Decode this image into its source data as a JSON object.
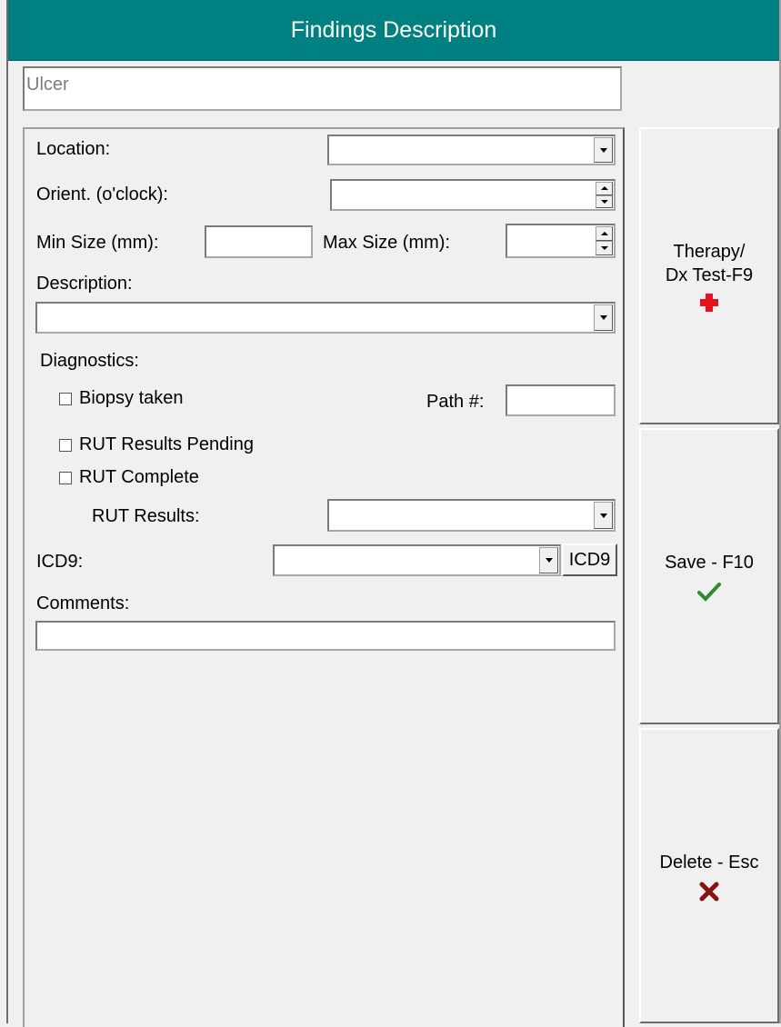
{
  "window": {
    "title": "Findings Description"
  },
  "finding": {
    "value": "Ulcer"
  },
  "form": {
    "location": {
      "label": "Location:",
      "value": ""
    },
    "orient": {
      "label": "Orient. (o'clock):",
      "value": ""
    },
    "min_size": {
      "label": "Min Size (mm):",
      "value": ""
    },
    "max_size": {
      "label": "Max Size (mm):",
      "value": ""
    },
    "description": {
      "label": "Description:",
      "value": ""
    },
    "diagnostics": {
      "label": "Diagnostics:",
      "biopsy_taken": {
        "label": "Biopsy taken",
        "checked": false
      },
      "path_num": {
        "label": "Path #:",
        "value": ""
      },
      "rut_pending": {
        "label": "RUT Results Pending",
        "checked": false
      },
      "rut_complete": {
        "label": "RUT Complete",
        "checked": false
      },
      "rut_results": {
        "label": "RUT Results:",
        "value": ""
      }
    },
    "icd9": {
      "label": "ICD9:",
      "value": "",
      "button_label": "ICD9"
    },
    "comments": {
      "label": "Comments:",
      "value": ""
    }
  },
  "side_buttons": {
    "therapy": {
      "line1": "Therapy/",
      "line2": "Dx Test-F9",
      "icon": "red-cross-icon",
      "icon_color": "#e81123"
    },
    "save": {
      "label": "Save - F10",
      "icon": "checkmark-icon",
      "icon_color": "#2e8b2e"
    },
    "delete": {
      "label": "Delete - Esc",
      "icon": "x-icon",
      "icon_color": "#8b1010"
    }
  },
  "colors": {
    "title_bar": "#008080",
    "background": "#f0f0f0"
  }
}
